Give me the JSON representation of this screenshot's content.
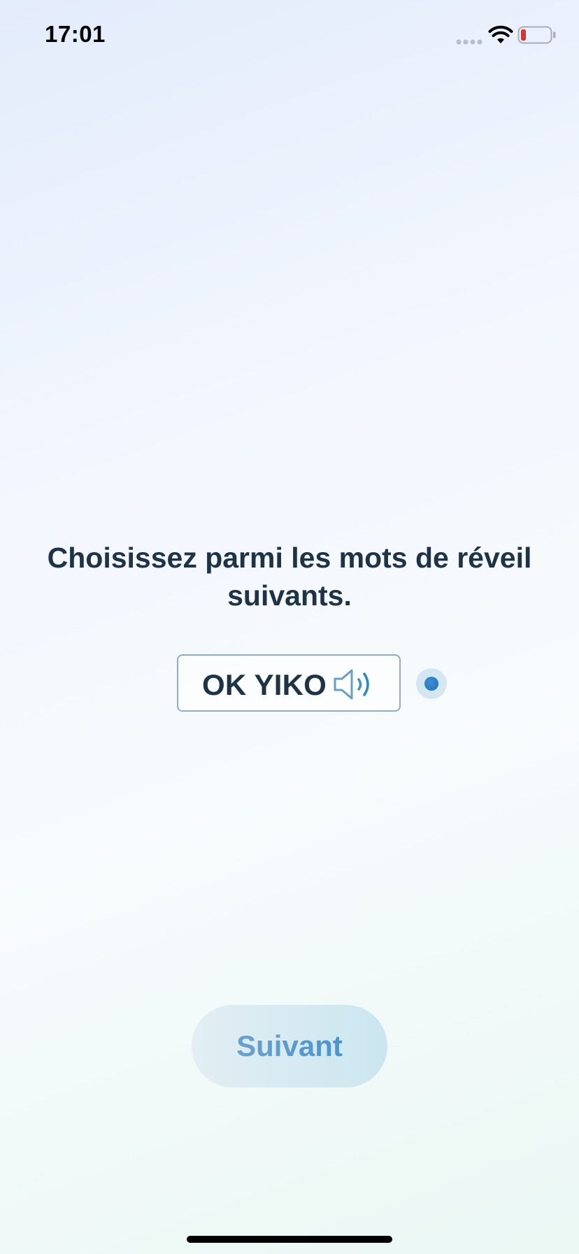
{
  "status_bar": {
    "time": "17:01",
    "signal_icon": "signal-dots-icon",
    "wifi_icon": "wifi-icon",
    "battery_icon": "battery-low-icon",
    "battery_color": "#e0302a"
  },
  "main": {
    "prompt": "Choisissez parmi les mots de réveil suivants.",
    "wake_words": [
      {
        "label": "OK YIKO",
        "icon": "speaker-icon",
        "selected": true
      }
    ]
  },
  "footer": {
    "next_label": "Suivant"
  },
  "colors": {
    "text": "#1e3346",
    "accent": "#2b86c9",
    "option_border": "#8eadc7"
  }
}
